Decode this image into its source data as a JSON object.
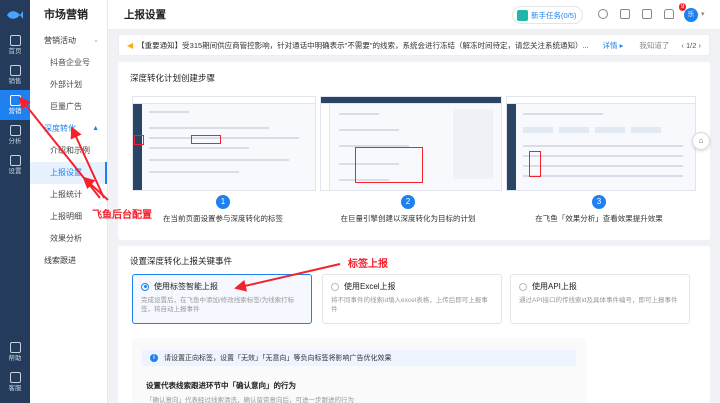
{
  "rail": {
    "items": [
      {
        "label": "首页",
        "icon": "home-icon"
      },
      {
        "label": "销售",
        "icon": "sales-icon"
      },
      {
        "label": "营销",
        "icon": "marketing-icon",
        "active": true
      },
      {
        "label": "分析",
        "icon": "analytics-icon"
      },
      {
        "label": "设置",
        "icon": "gear-icon"
      }
    ],
    "bottom": [
      {
        "label": "帮助",
        "icon": "help-icon"
      },
      {
        "label": "客服",
        "icon": "support-icon"
      }
    ]
  },
  "subnav": {
    "title": "市场营销",
    "groups": [
      {
        "label": "营销活动",
        "chevron": "⌄",
        "children": [
          "抖音企业号",
          "外部计划",
          "巨量广告"
        ]
      },
      {
        "label": "深度转化",
        "chevron": "▲",
        "open": true,
        "children": [
          "介绍和示例",
          "上报设置",
          "上报统计",
          "上报明细",
          "效果分析"
        ]
      },
      {
        "label": "线索跟进"
      }
    ],
    "selected": "上报设置"
  },
  "topbar": {
    "title": "上报设置",
    "task": "新手任务(0/5)",
    "badge": "9",
    "avatar": "乐"
  },
  "notice": {
    "text": "【重要通知】受315期间供应商管控影响，针对通话中明确表示\"不需要\"的线索，系统会进行冻结（解冻时间待定，请您关注系统通知）...",
    "link": "详情 ▸",
    "know": "我知道了",
    "pager": "‹ 1/2 ›"
  },
  "steps_card": {
    "title": "深度转化计划创建步骤",
    "steps": [
      {
        "num": "1",
        "text": "在当前页面设置参与深度转化的标签"
      },
      {
        "num": "2",
        "text": "在巨量引擎创建以深度转化为目标的计划"
      },
      {
        "num": "3",
        "text": "在飞鱼「效果分析」查看效果提升效果"
      }
    ]
  },
  "events_card": {
    "title": "设置深度转化上报关键事件",
    "options": [
      {
        "title": "使用标签智能上报",
        "desc": "完成设置后，在飞鱼中添加/修改线索标签/为线索打标签，将自动上报事件",
        "selected": true
      },
      {
        "title": "使用Excel上报",
        "desc": "将不同事件的线索id填入excel表格，上传后即可上报事件",
        "selected": false
      },
      {
        "title": "使用API上报",
        "desc": "通过API接口的传线索id及具体事件编号，即可上报事件",
        "selected": false
      }
    ],
    "info": "请设置正向标签，设置「无效」「无意向」等负向标签将影响广告优化效果",
    "setting_title": "设置代表线索跟进环节中「确认意向」的行为",
    "setting_sub": "「确认意向」代表经过线索清洗，确认留资意向后，可进一步跟进的行为"
  },
  "annotations": {
    "left": "飞鱼后台配置",
    "right": "标签上报"
  },
  "colors": {
    "accent": "#1f80ef",
    "rail": "#243b5c",
    "annotation": "#f5222d"
  }
}
